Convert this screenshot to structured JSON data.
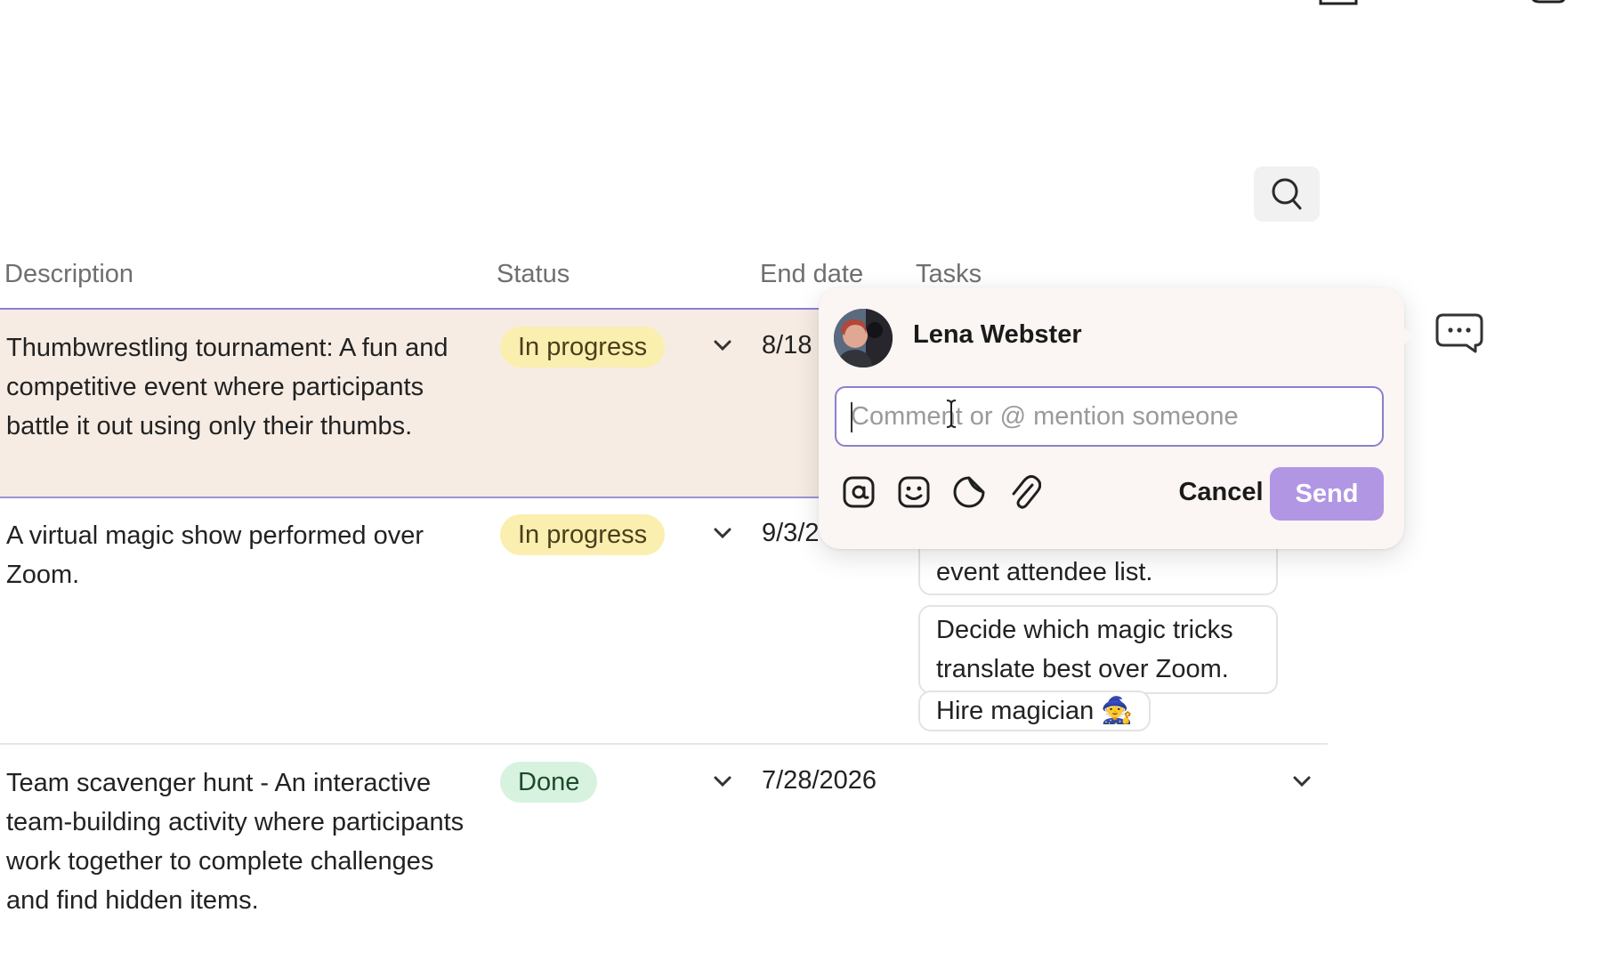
{
  "table": {
    "headers": {
      "description": "Description",
      "status": "Status",
      "end_date": "End date",
      "tasks": "Tasks"
    },
    "rows": [
      {
        "description": "Thumbwrestling tournament: A fun and competitive event where participants battle it out using only their thumbs.",
        "status": "In progress",
        "end_date": "8/18"
      },
      {
        "description": "A virtual magic show performed over Zoom.",
        "status": "In progress",
        "end_date": "9/3/2",
        "tasks": [
          "event attendee list.",
          "Decide which magic tricks translate best over Zoom.",
          "Hire magician 🧙"
        ]
      },
      {
        "description": "Team scavenger hunt - An interactive team-building activity where participants work together to complete challenges and find hidden items.",
        "status": "Done",
        "end_date": "7/28/2026"
      }
    ]
  },
  "comment_popover": {
    "user_name": "Lena Webster",
    "input_value": "",
    "input_placeholder": "Comment or @ mention someone",
    "cancel_label": "Cancel",
    "send_label": "Send",
    "tools": [
      "at-mention-icon",
      "emoji-icon",
      "sticker-icon",
      "attachment-icon"
    ]
  },
  "colors": {
    "in_progress_badge": "#fbefb0",
    "done_badge": "#d7f3df",
    "selected_row": "#f6ece4",
    "send_button": "#b196e4",
    "input_border": "#8b7fd0"
  }
}
